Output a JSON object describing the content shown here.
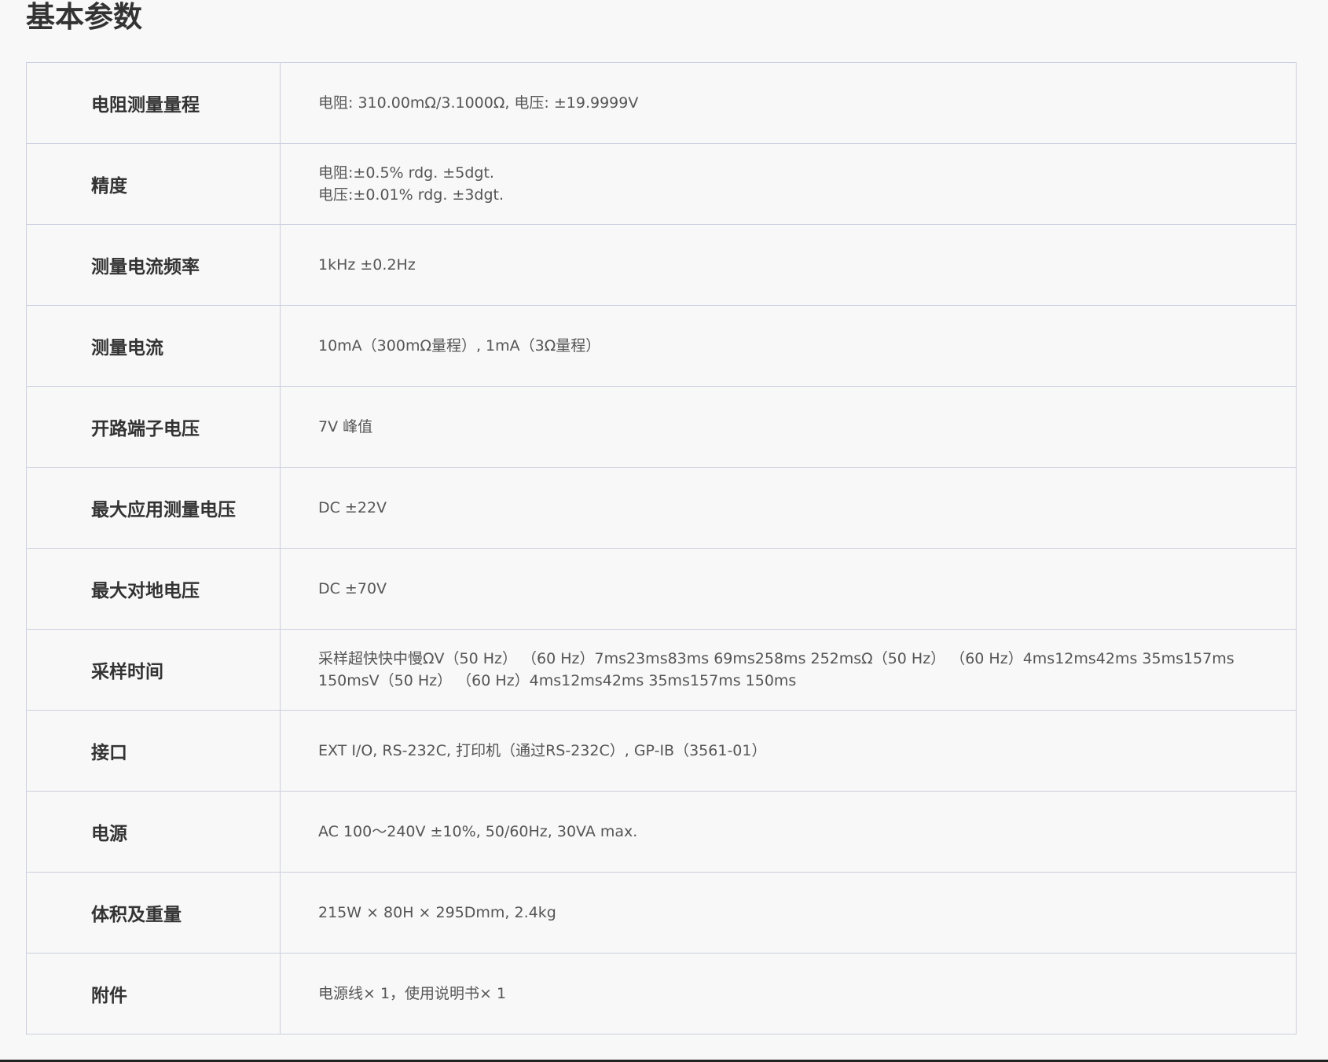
{
  "page": {
    "title": "基本参数"
  },
  "specs": [
    {
      "label": "电阻测量量程",
      "lines": [
        "电阻: 310.00mΩ/3.1000Ω, 电压: ±19.9999V"
      ]
    },
    {
      "label": "精度",
      "lines": [
        "电阻:±0.5% rdg. ±5dgt.",
        "电压:±0.01% rdg. ±3dgt."
      ]
    },
    {
      "label": "测量电流频率",
      "lines": [
        "1kHz ±0.2Hz"
      ]
    },
    {
      "label": "测量电流",
      "lines": [
        "10mA（300mΩ量程）, 1mA（3Ω量程）"
      ]
    },
    {
      "label": "开路端子电压",
      "lines": [
        "7V 峰值"
      ]
    },
    {
      "label": "最大应用测量电压",
      "lines": [
        "DC ±22V"
      ]
    },
    {
      "label": "最大对地电压",
      "lines": [
        "DC ±70V"
      ]
    },
    {
      "label": "采样时间",
      "lines": [
        "采样超快快中慢ΩV（50 Hz） （60 Hz）7ms23ms83ms 69ms258ms 252msΩ（50 Hz） （60 Hz）4ms12ms42ms 35ms157ms",
        "150msV（50 Hz） （60 Hz）4ms12ms42ms 35ms157ms 150ms"
      ]
    },
    {
      "label": "接口",
      "lines": [
        "EXT I/O, RS-232C, 打印机（通过RS-232C）, GP-IB（3561-01）"
      ]
    },
    {
      "label": "电源",
      "lines": [
        "AC 100～240V ±10%, 50/60Hz, 30VA max."
      ]
    },
    {
      "label": "体积及重量",
      "lines": [
        "215W × 80H × 295Dmm, 2.4kg"
      ]
    },
    {
      "label": "附件",
      "lines": [
        "电源线× 1，使用说明书× 1"
      ]
    }
  ],
  "colors": {
    "background": "#f8f8f8",
    "border": "#ccd0e0",
    "label_text": "#333333",
    "value_text": "#555555"
  }
}
